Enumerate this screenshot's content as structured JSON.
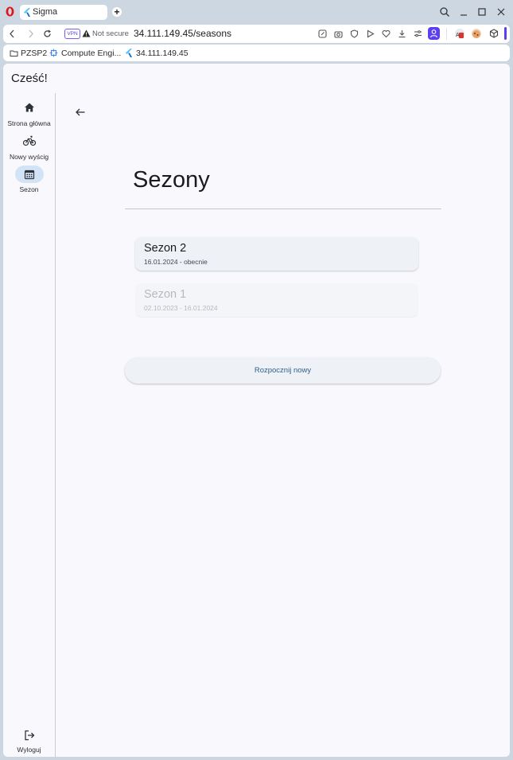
{
  "browser": {
    "tab_title": "Sigma",
    "vpn_label": "VPN",
    "security_label": "Not secure",
    "url": "34.111.149.45/seasons",
    "bookmarks": [
      {
        "label": "PZSP2",
        "icon": "folder-icon"
      },
      {
        "label": "Compute Engi...",
        "icon": "compute-engine-icon"
      },
      {
        "label": "34.111.149.45",
        "icon": "flutter-icon"
      }
    ]
  },
  "app": {
    "greeting": "Cześć!",
    "nav": [
      {
        "label": "Strona główna",
        "icon": "home-icon",
        "active": false
      },
      {
        "label": "Nowy wyścig",
        "icon": "bike-icon",
        "active": false
      },
      {
        "label": "Sezon",
        "icon": "calendar-icon",
        "active": true
      }
    ],
    "logout_label": "Wyloguj",
    "page_title": "Sezony",
    "seasons": [
      {
        "name": "Sezon 2",
        "dates": "16.01.2024 - obecnie",
        "enabled": true
      },
      {
        "name": "Sezon 1",
        "dates": "02.10.2023 - 16.01.2024",
        "enabled": false
      }
    ],
    "start_new_label": "Rozpocznij nowy"
  },
  "colors": {
    "accent": "#5b3ff1",
    "nav_active_bg": "#d3e3f6",
    "button_text": "#2f5f8c",
    "page_bg": "#f9f9fd"
  }
}
